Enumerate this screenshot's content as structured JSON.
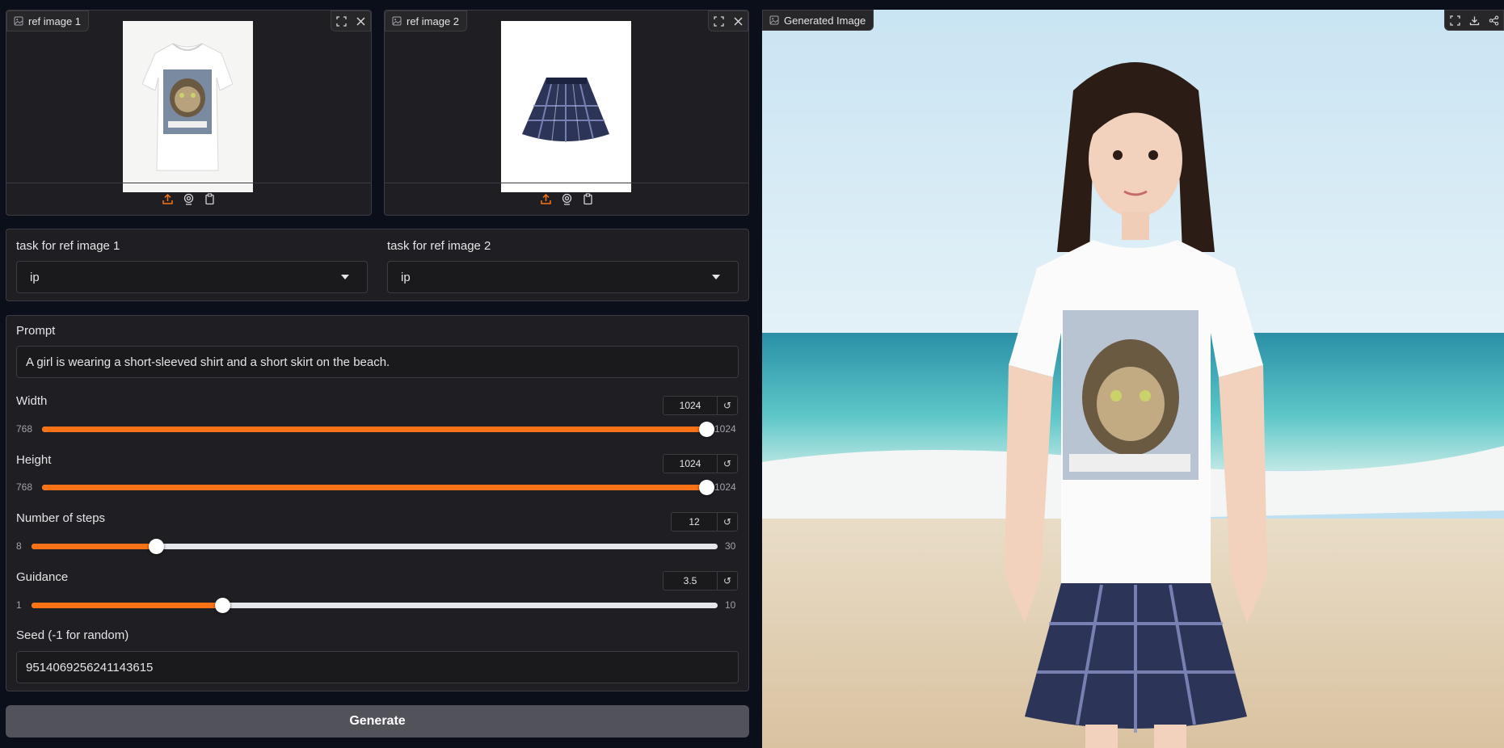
{
  "ref_images": [
    {
      "label": "ref image 1",
      "content": "white t-shirt with cat print",
      "upload_icon": "upload-icon",
      "webcam_icon": "webcam-icon",
      "clipboard_icon": "clipboard-icon"
    },
    {
      "label": "ref image 2",
      "content": "blue plaid pleated skirt",
      "upload_icon": "upload-icon",
      "webcam_icon": "webcam-icon",
      "clipboard_icon": "clipboard-icon"
    }
  ],
  "tasks": [
    {
      "label": "task for ref image 1",
      "value": "ip"
    },
    {
      "label": "task for ref image 2",
      "value": "ip"
    }
  ],
  "prompt": {
    "label": "Prompt",
    "value": "A girl is wearing a short-sleeved shirt and a short skirt on the beach."
  },
  "sliders": [
    {
      "label": "Width",
      "value": "1024",
      "min": "768",
      "max": "1024",
      "fraction": 1.0
    },
    {
      "label": "Height",
      "value": "1024",
      "min": "768",
      "max": "1024",
      "fraction": 1.0
    },
    {
      "label": "Number of steps",
      "value": "12",
      "min": "8",
      "max": "30",
      "fraction": 0.1818
    },
    {
      "label": "Guidance",
      "value": "3.5",
      "min": "1",
      "max": "10",
      "fraction": 0.2778
    }
  ],
  "seed": {
    "label": "Seed (-1 for random)",
    "value": "9514069256241143615"
  },
  "generate_label": "Generate",
  "output": {
    "label": "Generated Image",
    "content": "girl in cat t-shirt and plaid skirt on a beach"
  },
  "colors": {
    "accent": "#f97316",
    "panel": "#1f1f23",
    "border": "#3b3b41",
    "button": "#52525b"
  }
}
